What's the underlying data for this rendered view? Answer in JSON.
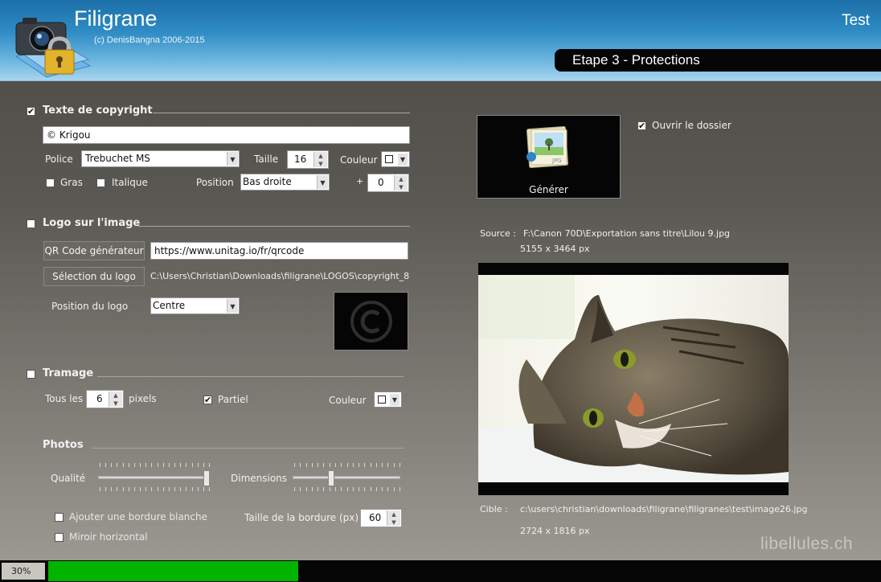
{
  "header": {
    "app_title": "Filigrane",
    "copyright": "(c) DenisBangna 2006-2015",
    "test_label": "Test",
    "step": "Etape 3 - Protections"
  },
  "copyright_text": {
    "enabled": true,
    "title": "Texte de copyright",
    "value": "© Krigou",
    "police_label": "Police",
    "police_value": "Trebuchet MS",
    "taille_label": "Taille",
    "taille_value": "16",
    "couleur_label": "Couleur",
    "gras_label": "Gras",
    "gras_checked": false,
    "italique_label": "Italique",
    "italique_checked": false,
    "position_label": "Position",
    "position_value": "Bas droite",
    "plus_label": "+",
    "offset_value": "0"
  },
  "logo": {
    "enabled": false,
    "title": "Logo sur l'image",
    "qr_button": "QR Code générateur",
    "qr_url": "https://www.unitag.io/fr/qrcode",
    "select_button": "Sélection du logo",
    "logo_path": "C:\\Users\\Christian\\Downloads\\filigrane\\LOGOS\\copyright_8",
    "position_label": "Position du logo",
    "position_value": "Centre"
  },
  "tramage": {
    "enabled": false,
    "title": "Tramage",
    "tous_les_label": "Tous les",
    "tous_les_value": "6",
    "pixels_label": "pixels",
    "partiel_label": "Partiel",
    "partiel_checked": true,
    "couleur_label": "Couleur"
  },
  "photos": {
    "title": "Photos",
    "qualite_label": "Qualité",
    "qualite_level": 1.0,
    "dimensions_label": "Dimensions",
    "dimensions_level": 0.35,
    "bordure_label": "Ajouter une bordure blanche",
    "bordure_checked": false,
    "miroir_label": "Miroir horizontal",
    "miroir_checked": false,
    "taille_bordure_label": "Taille de la bordure (px)",
    "taille_bordure_value": "60"
  },
  "right": {
    "generate_label": "Générer",
    "open_folder_label": "Ouvrir le dossier",
    "open_folder_checked": true,
    "source_label": "Source :",
    "source_path": "F:\\Canon 70D\\Exportation sans titre\\Lilou 9.jpg",
    "source_dims": "5155 x 3464 px",
    "cible_label": "Cible :",
    "cible_path": "c:\\users\\christian\\downloads\\filigrane\\filigranes\\test\\image26.jpg",
    "cible_dims": "2724 x 1816 px",
    "jpg_label": "JPG"
  },
  "progress": {
    "label": "30%",
    "value": 0.3
  },
  "watermark": "libellules.ch",
  "colors": {
    "progress_fill": "#00b400",
    "header_top": "#1c6fa8",
    "banner": "#050505"
  }
}
